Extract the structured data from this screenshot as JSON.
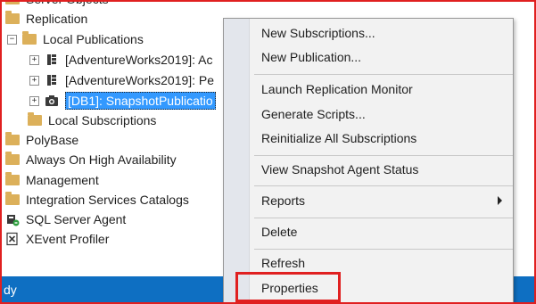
{
  "tree": {
    "server_objects": "Server Objects",
    "replication": "Replication",
    "local_publications": "Local Publications",
    "publication_1": "[AdventureWorks2019]: Ac",
    "publication_2": "[AdventureWorks2019]: Pe",
    "publication_3": "[DB1]: SnapshotPublicatio",
    "local_subscriptions": "Local Subscriptions",
    "polybase": "PolyBase",
    "always_on": "Always On High Availability",
    "management": "Management",
    "integration_services": "Integration Services Catalogs",
    "sql_server_agent": "SQL Server Agent",
    "xevent_profiler": "XEvent Profiler",
    "expander_collapsed": "+",
    "expander_expanded": "−"
  },
  "context_menu": {
    "new_subscriptions": "New Subscriptions...",
    "new_publication": "New Publication...",
    "launch_monitor": "Launch Replication Monitor",
    "generate_scripts": "Generate Scripts...",
    "reinitialize": "Reinitialize All Subscriptions",
    "view_snapshot_status": "View Snapshot Agent Status",
    "reports": "Reports",
    "delete": "Delete",
    "refresh": "Refresh",
    "properties": "Properties"
  },
  "status_bar": {
    "text": "dy"
  },
  "colors": {
    "selection": "#3399ff",
    "status_bar": "#0e6fc2",
    "highlight": "#e02020",
    "folder": "#dcb05a"
  },
  "icons": {
    "folder": "folder-icon",
    "publication": "publication-icon",
    "snapshot_publication": "camera-icon",
    "agent": "sql-agent-icon",
    "xevent": "xevent-profiler-icon"
  }
}
